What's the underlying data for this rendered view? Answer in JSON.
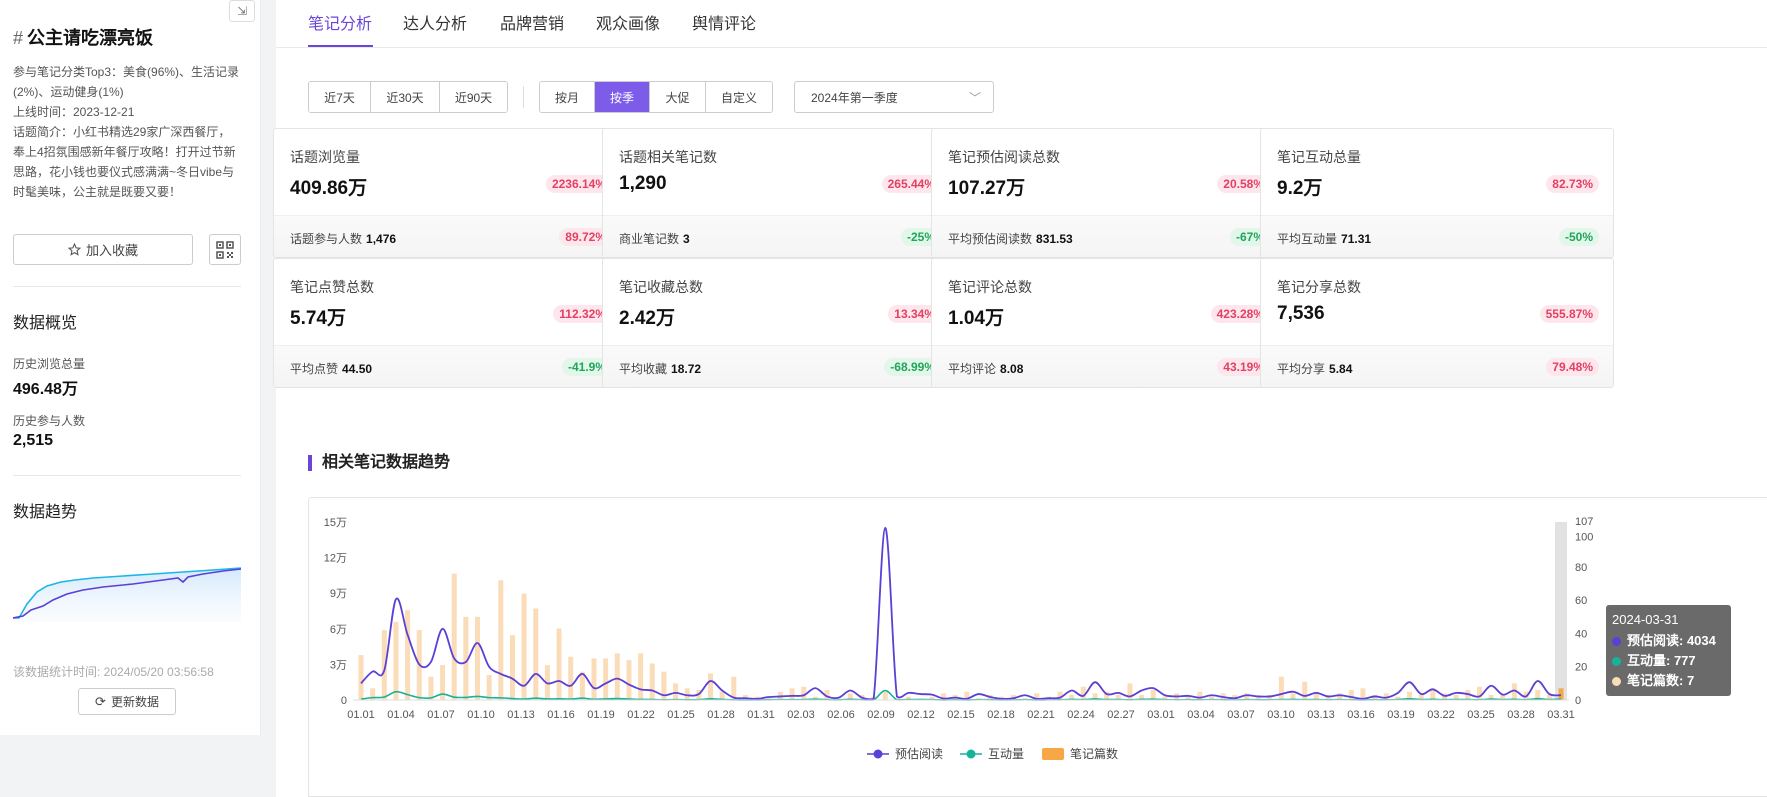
{
  "sidebar": {
    "title": "公主请吃漂亮饭",
    "categories": "参与笔记分类Top3：美食(96%)、生活记录(2%)、运动健身(1%)",
    "online_time": "上线时间：2023-12-21",
    "intro": "话题简介：小红书精选29家广深西餐厅，奉上4招氛围感新年餐厅攻略！打开过节新思路，花小钱也要仪式感满满~冬日vibe与时髦美味，公主就是既要又要！",
    "fav_label": "加入收藏",
    "overview_heading": "数据概览",
    "history_views_label": "历史浏览总量",
    "history_views_value": "496.48万",
    "history_participants_label": "历史参与人数",
    "history_participants_value": "2,515",
    "trend_heading": "数据趋势",
    "stat_time": "该数据统计时间:   2024/05/20 03:56:58",
    "refresh_label": "更新数据"
  },
  "tabs": [
    "笔记分析",
    "达人分析",
    "品牌营销",
    "观众画像",
    "舆情评论"
  ],
  "filters": {
    "range": [
      "近7天",
      "近30天",
      "近90天"
    ],
    "period": [
      "按月",
      "按季",
      "大促",
      "自定义"
    ],
    "period_active": 1,
    "quarter": "2024年第一季度"
  },
  "cards": [
    {
      "label": "话题浏览量",
      "value": "409.86万",
      "pct": "2236.14%",
      "pct_dir": "up",
      "sub_label": "话题参与人数",
      "sub_value": "1,476",
      "sub_pct": "89.72%",
      "sub_dir": "up"
    },
    {
      "label": "话题相关笔记数",
      "value": "1,290",
      "pct": "265.44%",
      "pct_dir": "up",
      "sub_label": "商业笔记数",
      "sub_value": "3",
      "sub_pct": "-25%",
      "sub_dir": "down"
    },
    {
      "label": "笔记预估阅读总数",
      "value": "107.27万",
      "pct": "20.58%",
      "pct_dir": "up",
      "sub_label": "平均预估阅读数",
      "sub_value": "831.53",
      "sub_pct": "-67%",
      "sub_dir": "down"
    },
    {
      "label": "笔记互动总量",
      "value": "9.2万",
      "pct": "82.73%",
      "pct_dir": "up",
      "sub_label": "平均互动量",
      "sub_value": "71.31",
      "sub_pct": "-50%",
      "sub_dir": "down"
    },
    {
      "label": "笔记点赞总数",
      "value": "5.74万",
      "pct": "112.32%",
      "pct_dir": "up",
      "sub_label": "平均点赞",
      "sub_value": "44.50",
      "sub_pct": "-41.9%",
      "sub_dir": "down"
    },
    {
      "label": "笔记收藏总数",
      "value": "2.42万",
      "pct": "13.34%",
      "pct_dir": "up",
      "sub_label": "平均收藏",
      "sub_value": "18.72",
      "sub_pct": "-68.99%",
      "sub_dir": "down"
    },
    {
      "label": "笔记评论总数",
      "value": "1.04万",
      "pct": "423.28%",
      "pct_dir": "up",
      "sub_label": "平均评论",
      "sub_value": "8.08",
      "sub_pct": "43.19%",
      "sub_dir": "up"
    },
    {
      "label": "笔记分享总数",
      "value": "7,536",
      "pct": "555.87%",
      "pct_dir": "up",
      "sub_label": "平均分享",
      "sub_value": "5.84",
      "sub_pct": "79.48%",
      "sub_dir": "up"
    }
  ],
  "section_title": "相关笔记数据趋势",
  "colors": {
    "accent": "#6b45d8",
    "reads": "#5b3fd6",
    "interactions": "#16b29a",
    "notes_bar": "#fbdcb8",
    "notes_legend": "#f7a744",
    "up": "#e34063",
    "down": "#1ea65a"
  },
  "chart_data": {
    "type": "bar",
    "x_ticks": [
      "01.01",
      "01.04",
      "01.07",
      "01.10",
      "01.13",
      "01.16",
      "01.19",
      "01.22",
      "01.25",
      "01.28",
      "01.31",
      "02.03",
      "02.06",
      "02.09",
      "02.12",
      "02.15",
      "02.18",
      "02.21",
      "02.24",
      "02.27",
      "03.01",
      "03.04",
      "03.07",
      "03.10",
      "03.13",
      "03.16",
      "03.19",
      "03.22",
      "03.25",
      "03.28",
      "03.31"
    ],
    "y_left_ticks": [
      "0",
      "3万",
      "6万",
      "9万",
      "12万",
      "15万"
    ],
    "y_left_range": [
      0,
      150000
    ],
    "y_right_ticks": [
      "0",
      "20",
      "40",
      "60",
      "80",
      "100",
      "107"
    ],
    "y_right_range": [
      0,
      107
    ],
    "series": [
      {
        "name": "预估阅读",
        "type": "line",
        "axis": "left",
        "values": [
          14000,
          24000,
          25000,
          85000,
          55000,
          30000,
          32000,
          60000,
          35000,
          32000,
          48000,
          28000,
          22000,
          18000,
          12000,
          22000,
          14000,
          16000,
          12000,
          22000,
          10000,
          14000,
          18000,
          13000,
          9000,
          8000,
          4000,
          6000,
          4000,
          5000,
          16000,
          8000,
          2000,
          1500,
          1000,
          2500,
          3000,
          3500,
          4000,
          10000,
          3000,
          2000,
          8000,
          2000,
          1000,
          145000,
          3000,
          6000,
          5000,
          4500,
          1200,
          2000,
          1000,
          5000,
          2500,
          1000,
          1500,
          4000,
          1000,
          1500,
          2000,
          8000,
          3500,
          15000,
          5000,
          6000,
          3000,
          8000,
          10000,
          4000,
          3000,
          3500,
          2000,
          4000,
          2500,
          1500,
          4000,
          3000,
          3000,
          5000,
          7000,
          3500,
          6000,
          3000,
          4000,
          2500,
          1000,
          3000,
          2000,
          6000,
          15000,
          5000,
          9000,
          3500,
          6000,
          5000,
          3000,
          12000,
          4500,
          8000,
          3000,
          16000,
          5000,
          4034
        ]
      },
      {
        "name": "互动量",
        "type": "line",
        "axis": "left",
        "values": [
          800,
          2000,
          2500,
          7000,
          4500,
          2000,
          1800,
          5000,
          2400,
          2200,
          3000,
          2000,
          1800,
          1200,
          800,
          1500,
          900,
          1000,
          800,
          1500,
          600,
          900,
          1200,
          800,
          500,
          400,
          200,
          300,
          200,
          300,
          1000,
          500,
          100,
          80,
          60,
          200,
          250,
          280,
          300,
          700,
          200,
          100,
          600,
          150,
          80,
          8000,
          200,
          400,
          350,
          300,
          80,
          140,
          70,
          300,
          180,
          70,
          100,
          280,
          70,
          100,
          140,
          500,
          240,
          900,
          350,
          400,
          200,
          560,
          700,
          280,
          200,
          240,
          140,
          280,
          180,
          100,
          280,
          200,
          200,
          350,
          500,
          240,
          420,
          200,
          280,
          180,
          70,
          200,
          140,
          420,
          1000,
          350,
          600,
          240,
          420,
          350,
          200,
          840,
          310,
          560,
          200,
          1120,
          350,
          777
        ]
      },
      {
        "name": "笔记篇数",
        "type": "bar",
        "axis": "right",
        "values": [
          27,
          7,
          42,
          47,
          54,
          42,
          14,
          21,
          76,
          50,
          50,
          15,
          72,
          39,
          64,
          55,
          21,
          43,
          26,
          17,
          25,
          25,
          28,
          24,
          28,
          22,
          17,
          10,
          7,
          6,
          16,
          5,
          14,
          3,
          2,
          2,
          5,
          7,
          8,
          2,
          6,
          1,
          4,
          3,
          2,
          5,
          1,
          2,
          1,
          2,
          4,
          3,
          5,
          1,
          3,
          2,
          3,
          1,
          4,
          2,
          5,
          3,
          8,
          4,
          5,
          3,
          10,
          3,
          6,
          2,
          4,
          3,
          5,
          2,
          4,
          3,
          4,
          2,
          3,
          14,
          4,
          11,
          5,
          3,
          4,
          6,
          7,
          3,
          4,
          2,
          5,
          3,
          7,
          4,
          3,
          6,
          8,
          3,
          3,
          10,
          5,
          6,
          3,
          7
        ]
      }
    ],
    "legend": [
      "预估阅读",
      "互动量",
      "笔记篇数"
    ],
    "legend_position": "bottom-center",
    "tooltip": {
      "date": "2024-03-31",
      "rows": [
        "预估阅读: 4034",
        "互动量: 777",
        "笔记篇数: 7"
      ]
    }
  }
}
